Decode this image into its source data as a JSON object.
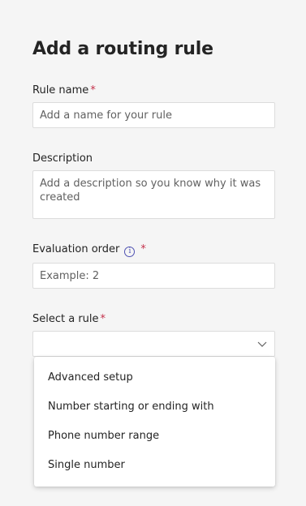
{
  "form": {
    "title": "Add a routing rule",
    "rule_name": {
      "label": "Rule name",
      "required_mark": "*",
      "placeholder": "Add a name for your rule"
    },
    "description": {
      "label": "Description",
      "placeholder": "Add a description so you know why it was created"
    },
    "evaluation_order": {
      "label": "Evaluation order",
      "info_icon": "i",
      "required_mark": "*",
      "placeholder": "Example: 2"
    },
    "select_rule": {
      "label": "Select a rule",
      "required_mark": "*",
      "value": ""
    }
  },
  "dropdown": {
    "options": [
      "Advanced setup",
      "Number starting or ending with",
      "Phone number range",
      "Single number"
    ]
  }
}
